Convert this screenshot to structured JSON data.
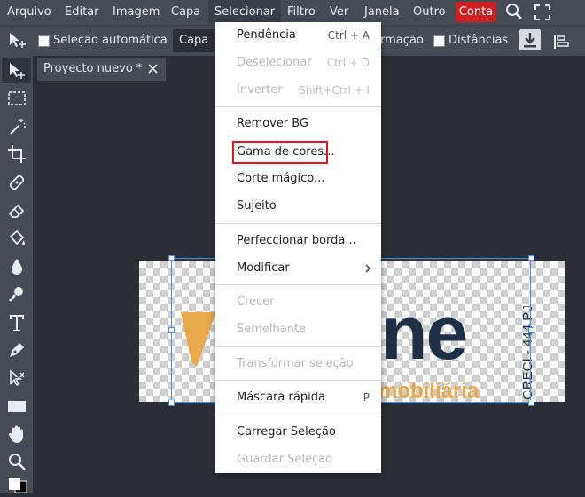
{
  "menubar": {
    "items": [
      "Arquivo",
      "Editar",
      "Imagem",
      "Capa",
      "Selecionar",
      "Filtro",
      "Ver",
      "Janela",
      "Outro"
    ],
    "account": "Conta",
    "account_color": "#cf1f23"
  },
  "options": {
    "auto_select": "Seleção automática",
    "layer_select": "Capa",
    "transform": "rmação",
    "distances": "Distâncias"
  },
  "tab": {
    "title": "Proyecto nuevo *"
  },
  "dropdown": {
    "items": [
      {
        "label": "Pendência",
        "shortcut": "Ctrl + A"
      },
      {
        "label": "Deselecionar",
        "shortcut": "Ctrl + D"
      },
      {
        "label": "Inverter",
        "shortcut": "Shift+Ctrl + I"
      },
      {
        "label": "Remover BG"
      },
      {
        "label": "Gama de cores..."
      },
      {
        "label": "Corte mágico..."
      },
      {
        "label": "Sujeito"
      },
      {
        "label": "Perfeccionar borda..."
      },
      {
        "label": "Modificar"
      },
      {
        "label": "Crecer"
      },
      {
        "label": "Semelhante"
      },
      {
        "label": "Transformar seleção"
      },
      {
        "label": "Máscara rápida",
        "shortcut": "P"
      },
      {
        "label": "Carregar Seleção"
      },
      {
        "label": "Guardar Seleção"
      }
    ]
  },
  "canvas": {
    "logo_text": "ne",
    "logo_subtitle": "mobiliária",
    "logo_creci": "CRECI - 444 PJ",
    "colors": {
      "navy": "#1e3048",
      "gold": "#e7a94a"
    }
  },
  "tools": [
    "move-tool",
    "marquee-tool",
    "magic-wand-tool",
    "crop-tool",
    "healing-tool",
    "eraser-tool",
    "bucket-tool",
    "blur-tool",
    "dodge-tool",
    "text-tool",
    "pen-tool",
    "path-select-tool",
    "shape-tool",
    "hand-tool",
    "zoom-tool"
  ]
}
